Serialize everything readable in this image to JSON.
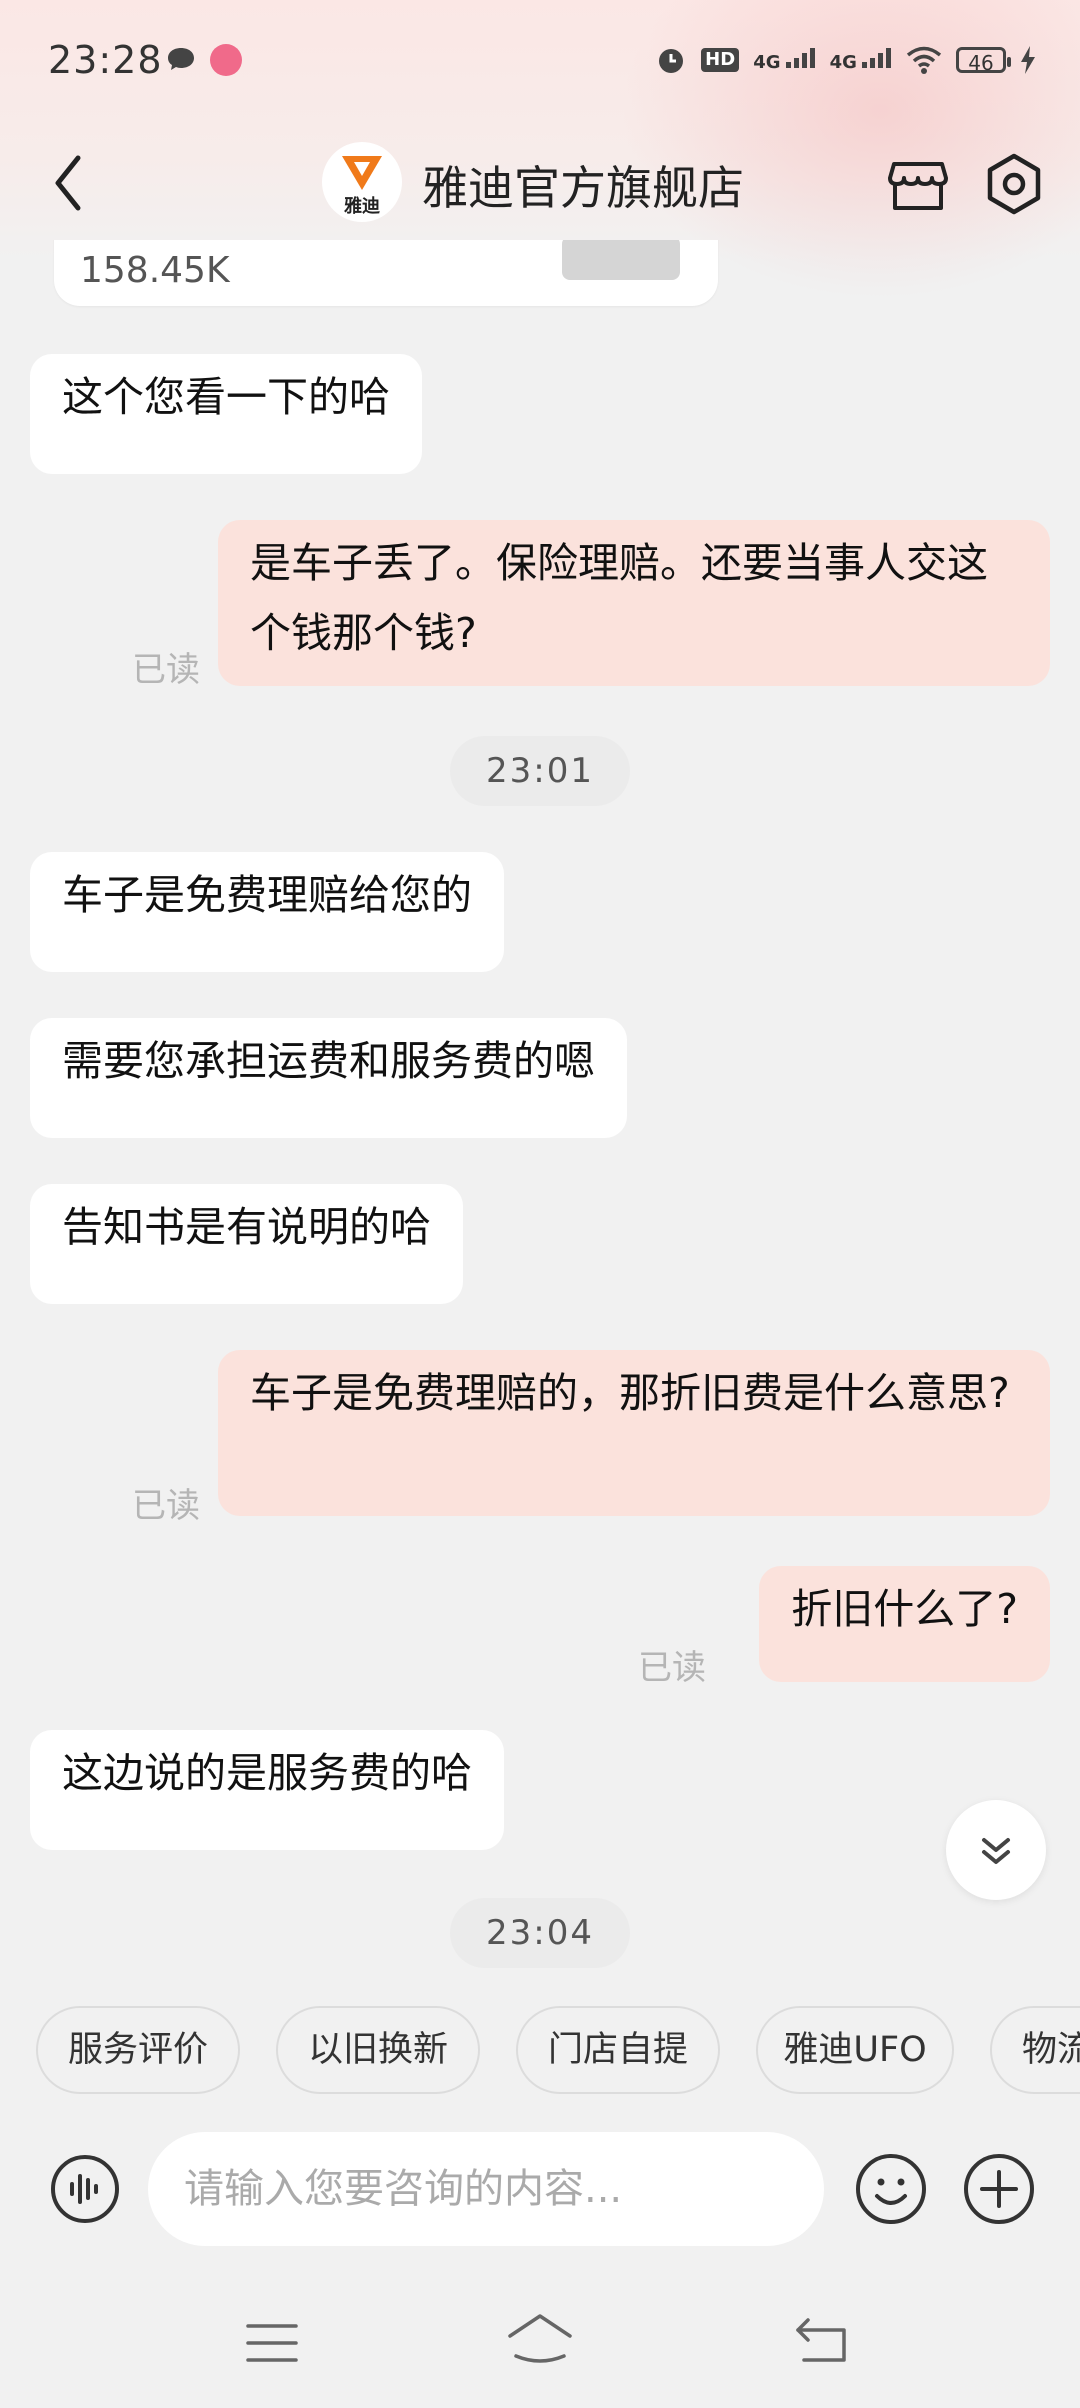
{
  "status_bar": {
    "time": "23:28",
    "battery": "46",
    "network_1": "4G",
    "network_2": "4G",
    "hd": "HD"
  },
  "header": {
    "shop_name": "雅迪官方旗舰店",
    "logo_text": "雅迪"
  },
  "product_card": {
    "price": "158.45K"
  },
  "messages": [
    {
      "side": "in",
      "text": "这个您看一下的哈"
    },
    {
      "side": "out",
      "text": "是车子丢了。保险理赔。还要当事人交这个钱那个钱?",
      "status": "已读"
    },
    {
      "type": "time",
      "text": "23:01"
    },
    {
      "side": "in",
      "text": "车子是免费理赔给您的"
    },
    {
      "side": "in",
      "text": "需要您承担运费和服务费的嗯"
    },
    {
      "side": "in",
      "text": "告知书是有说明的哈"
    },
    {
      "side": "out",
      "text": "车子是免费理赔的，那折旧费是什么意思?",
      "status": "已读"
    },
    {
      "side": "out",
      "text": "折旧什么了?",
      "status": "已读"
    },
    {
      "side": "in",
      "text": "这边说的是服务费的哈"
    },
    {
      "type": "time",
      "text": "23:04"
    }
  ],
  "quick_replies": [
    "服务评价",
    "以旧换新",
    "门店自提",
    "雅迪UFO",
    "物流"
  ],
  "input": {
    "placeholder": "请输入您要咨询的内容..."
  },
  "colors": {
    "outgoing_bubble": "#fbe2dc",
    "incoming_bubble": "#ffffff",
    "background": "#f1f1f1",
    "logo_orange": "#f07a1a"
  },
  "icons": [
    "back-arrow-icon",
    "store-icon",
    "settings-icon",
    "scroll-down-icon",
    "voice-icon",
    "emoji-icon",
    "plus-icon",
    "nav-menu-icon",
    "nav-home-icon",
    "nav-back-icon"
  ]
}
